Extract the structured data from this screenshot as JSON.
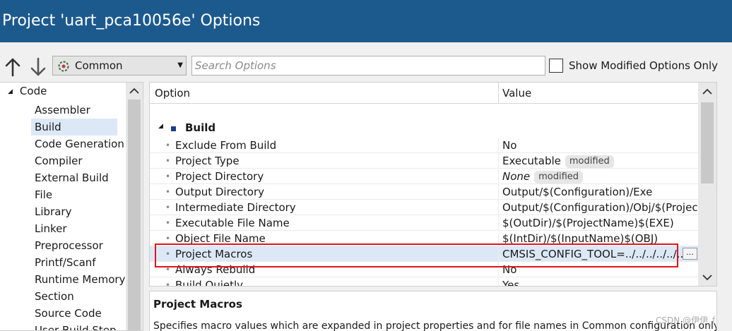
{
  "window": {
    "title": "Project 'uart_pca10056e' Options"
  },
  "toolbar": {
    "config_selected": "Common",
    "search_placeholder": "Search Options",
    "show_modified_label": "Show Modified Options Only"
  },
  "tree": {
    "root_label": "Code",
    "items": [
      {
        "label": "Assembler"
      },
      {
        "label": "Build"
      },
      {
        "label": "Code Generation"
      },
      {
        "label": "Compiler"
      },
      {
        "label": "External Build"
      },
      {
        "label": "File"
      },
      {
        "label": "Library"
      },
      {
        "label": "Linker"
      },
      {
        "label": "Preprocessor"
      },
      {
        "label": "Printf/Scanf"
      },
      {
        "label": "Runtime Memory"
      },
      {
        "label": "Section"
      },
      {
        "label": "Source Code"
      },
      {
        "label": "User Build Step"
      }
    ],
    "selected_index": 1
  },
  "grid": {
    "column_option": "Option",
    "column_value": "Value",
    "section_label": "Build",
    "rows": [
      {
        "name": "Exclude From Build",
        "value": "No",
        "badge": ""
      },
      {
        "name": "Project Type",
        "value": "Executable",
        "badge": "modified"
      },
      {
        "name": "Project Directory",
        "value": "None",
        "badge": "modified"
      },
      {
        "name": "Output Directory",
        "value": "Output/$(Configuration)/Exe",
        "badge": ""
      },
      {
        "name": "Intermediate Directory",
        "value": "Output/$(Configuration)/Obj/$(ProjectName)",
        "badge": ""
      },
      {
        "name": "Executable File Name",
        "value": "$(OutDir)/$(ProjectName)$(EXE)",
        "badge": ""
      },
      {
        "name": "Object File Name",
        "value": "$(IntDir)/$(InputName)$(OBJ)",
        "badge": ""
      },
      {
        "name": "Project Macros",
        "value": "CMSIS_CONFIG_TOOL=../../../../../../external",
        "badge": ""
      },
      {
        "name": "Always Rebuild",
        "value": "No",
        "badge": ""
      },
      {
        "name": "Build Quietly",
        "value": "Yes",
        "badge": ""
      }
    ],
    "ellipsis_label": "...",
    "selected_row": 7
  },
  "description": {
    "title": "Project Macros",
    "text": "Specifies macro values which are expanded in project properties and for file names in Common configuration only."
  },
  "watermark": "CSDN @伊伊_f",
  "colors": {
    "titlebar": "#1c5a8e",
    "selection": "#dce8f6",
    "highlight_box": "#e0141a"
  }
}
